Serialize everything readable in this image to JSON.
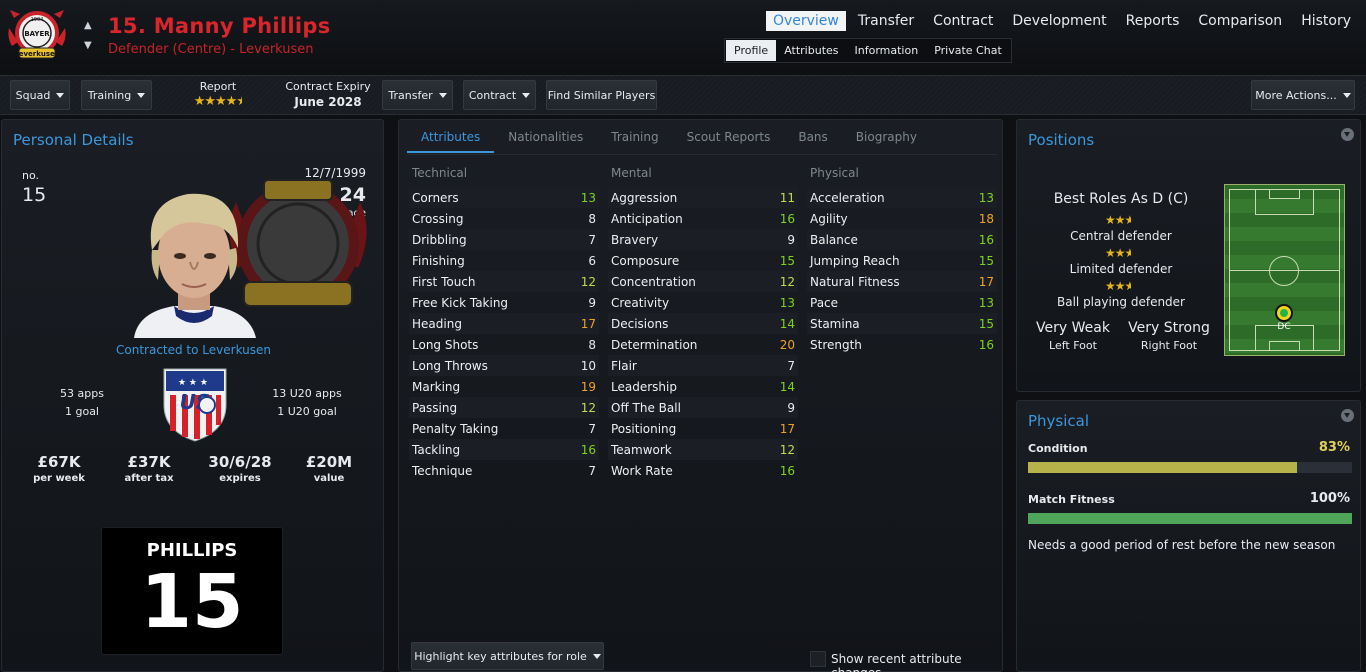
{
  "header": {
    "player_name": "15. Manny Phillips",
    "role_line": "Defender (Centre) - Leverkusen",
    "crest_text": [
      "1904",
      "BAYER",
      "Leverkusen"
    ]
  },
  "topnav": [
    "Overview",
    "Transfer",
    "Contract",
    "Development",
    "Reports",
    "Comparison",
    "History"
  ],
  "subnav": [
    "Profile",
    "Attributes",
    "Information",
    "Private Chat"
  ],
  "toolbar": {
    "squad": "Squad",
    "training": "Training",
    "report_label": "Report",
    "report_stars": 4.5,
    "contract_label": "Contract Expiry",
    "contract_value": "June 2028",
    "transfer": "Transfer",
    "contract": "Contract",
    "find_similar": "Find Similar Players",
    "more_actions": "More Actions..."
  },
  "personal": {
    "title": "Personal Details",
    "no_label": "no.",
    "no": "15",
    "dob": "12/7/1999",
    "age": "24",
    "age_label": "age",
    "contracted": "Contracted to Leverkusen",
    "apps": "53 apps",
    "goals": "1 goal",
    "u20_apps": "13 U20 apps",
    "u20_goals": "1 U20 goal",
    "stats": [
      {
        "v": "£67K",
        "l": "per week"
      },
      {
        "v": "£37K",
        "l": "after tax"
      },
      {
        "v": "30/6/28",
        "l": "expires"
      },
      {
        "v": "£20M",
        "l": "value"
      }
    ],
    "shirt_name": "PHILLIPS",
    "shirt_no": "15",
    "flag_text": "US"
  },
  "attributes": {
    "tabs": [
      "Attributes",
      "Nationalities",
      "Training",
      "Scout Reports",
      "Bans",
      "Biography"
    ],
    "technical_label": "Technical",
    "mental_label": "Mental",
    "physical_label": "Physical",
    "technical": [
      [
        "Corners",
        13
      ],
      [
        "Crossing",
        8
      ],
      [
        "Dribbling",
        7
      ],
      [
        "Finishing",
        6
      ],
      [
        "First Touch",
        12
      ],
      [
        "Free Kick Taking",
        9
      ],
      [
        "Heading",
        17
      ],
      [
        "Long Shots",
        8
      ],
      [
        "Long Throws",
        10
      ],
      [
        "Marking",
        19
      ],
      [
        "Passing",
        12
      ],
      [
        "Penalty Taking",
        7
      ],
      [
        "Tackling",
        16
      ],
      [
        "Technique",
        7
      ]
    ],
    "mental": [
      [
        "Aggression",
        11
      ],
      [
        "Anticipation",
        16
      ],
      [
        "Bravery",
        9
      ],
      [
        "Composure",
        15
      ],
      [
        "Concentration",
        12
      ],
      [
        "Creativity",
        13
      ],
      [
        "Decisions",
        14
      ],
      [
        "Determination",
        20
      ],
      [
        "Flair",
        7
      ],
      [
        "Leadership",
        14
      ],
      [
        "Off The Ball",
        9
      ],
      [
        "Positioning",
        17
      ],
      [
        "Teamwork",
        12
      ],
      [
        "Work Rate",
        16
      ]
    ],
    "physical": [
      [
        "Acceleration",
        13
      ],
      [
        "Agility",
        18
      ],
      [
        "Balance",
        16
      ],
      [
        "Jumping Reach",
        15
      ],
      [
        "Natural Fitness",
        17
      ],
      [
        "Pace",
        13
      ],
      [
        "Stamina",
        15
      ],
      [
        "Strength",
        16
      ]
    ],
    "highlight_btn": "Highlight key attributes for role",
    "show_changes": "Show recent attribute changes"
  },
  "positions": {
    "title": "Positions",
    "best_roles": "Best Roles As D (C)",
    "roles": [
      {
        "name": "Central defender",
        "stars": 2.5
      },
      {
        "name": "Limited defender",
        "stars": 2.5
      },
      {
        "name": "Ball playing defender",
        "stars": 2.5
      }
    ],
    "left_foot": "Very Weak",
    "left_foot_label": "Left Foot",
    "right_foot": "Very Strong",
    "right_foot_label": "Right Foot",
    "pos_label": "DC"
  },
  "physical": {
    "title": "Physical",
    "condition_label": "Condition",
    "condition": "83%",
    "condition_frac": 0.83,
    "fitness_label": "Match Fitness",
    "fitness": "100%",
    "fitness_frac": 1.0,
    "note": "Needs a good period of rest before the new season",
    "colors": {
      "condition": "#b5b34a",
      "fitness": "#4fa65a"
    }
  }
}
